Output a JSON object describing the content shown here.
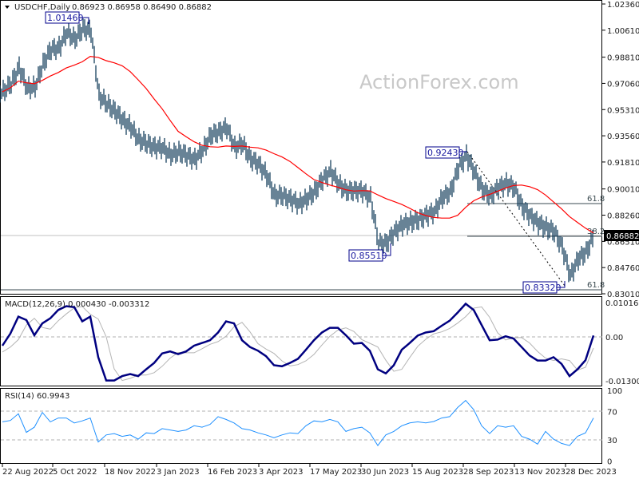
{
  "header": {
    "symbol": "USDCHF,Daily",
    "ohlc": "0.86923 0.86958 0.86490 0.86882",
    "menu_icon": "triangle-down-icon"
  },
  "watermark": "ActionForex.com",
  "current_price_label": "0.86882",
  "annotations": {
    "high_2022": "1.01460",
    "high_sep": "0.92430",
    "low_jul": "0.85510",
    "low_dec": "0.83320",
    "fib_upper": "61.8",
    "fib_mid": "38.2",
    "fib_lower": "61.8"
  },
  "colors": {
    "bars": "#17405e",
    "moving_average": "#ff0000",
    "macd": "#000080",
    "signal": "#b4b4b4",
    "rsi": "#1e90ff",
    "annotation": "#00008b"
  },
  "chart_data": [
    {
      "type": "line",
      "title": "USDCHF,Daily",
      "interval": "weekly samples from 22 Aug 2022",
      "price_axis_ticks": [
        "1.02360",
        "1.00610",
        "0.98810",
        "0.97060",
        "0.95310",
        "0.93560",
        "0.91810",
        "0.90010",
        "0.88260",
        "0.86510",
        "0.84760",
        "0.83010"
      ],
      "ylim": [
        0.8301,
        1.0236
      ],
      "date_ticks": [
        "22 Aug 2022",
        "5 Oct 2022",
        "18 Nov 2022",
        "3 Jan 2023",
        "16 Feb 2023",
        "3 Apr 2023",
        "17 May 2023",
        "30 Jun 2023",
        "15 Aug 2023",
        "28 Sep 2023",
        "13 Nov 2023",
        "28 Dec 2023"
      ],
      "close": [
        0.965,
        0.9703,
        0.981,
        0.9677,
        0.9677,
        0.9837,
        0.9933,
        0.9943,
        1.005,
        0.9996,
        1.0076,
        1.005,
        0.9623,
        0.957,
        0.9517,
        0.9463,
        0.941,
        0.933,
        0.9304,
        0.9277,
        0.9277,
        0.9224,
        0.925,
        0.9224,
        0.9197,
        0.9261,
        0.9357,
        0.9384,
        0.941,
        0.9277,
        0.9304,
        0.9197,
        0.917,
        0.909,
        0.8957,
        0.8957,
        0.893,
        0.8904,
        0.893,
        0.8984,
        0.9064,
        0.9117,
        0.9037,
        0.8984,
        0.8994,
        0.8984,
        0.8941,
        0.8637,
        0.8637,
        0.8717,
        0.876,
        0.8781,
        0.8797,
        0.8824,
        0.8851,
        0.8941,
        0.8984,
        0.9144,
        0.9224,
        0.9117,
        0.8994,
        0.8957,
        0.901,
        0.9037,
        0.901,
        0.8877,
        0.8824,
        0.8771,
        0.8744,
        0.8717,
        0.8611,
        0.8424,
        0.8531,
        0.8584,
        0.8688
      ],
      "key_levels": {
        "high": 1.0146,
        "swing_high": 0.9243,
        "swing_low": 0.8551,
        "low": 0.8332,
        "fib_61_8_upper": 0.8904,
        "fib_38_2": 0.8685,
        "fib_61_8_lower": 0.833
      },
      "last_price": 0.86882
    },
    {
      "type": "line",
      "title": "MACD(12,26,9) 0.000430 -0.003312",
      "axis_ticks": [
        "0.010166",
        "0.00",
        "-0.013006"
      ],
      "ylim": [
        -0.013006,
        0.010166
      ],
      "macd": [
        -0.0026,
        0.001,
        0.006,
        0.005,
        0.0005,
        0.004,
        0.0055,
        0.008,
        0.0091,
        0.0088,
        0.0046,
        0.006,
        -0.006,
        -0.0129,
        -0.0129,
        -0.0116,
        -0.011,
        -0.0116,
        -0.0096,
        -0.0077,
        -0.0049,
        -0.0043,
        -0.0051,
        -0.0043,
        -0.0026,
        -0.0018,
        -0.001,
        0.0013,
        0.0046,
        0.004,
        -0.001,
        -0.003,
        -0.0041,
        -0.0057,
        -0.0084,
        -0.0087,
        -0.0077,
        -0.0065,
        -0.0038,
        -0.001,
        0.0013,
        0.0027,
        0.0027,
        0.0005,
        -0.002,
        -0.0018,
        -0.0041,
        -0.0096,
        -0.0108,
        -0.0084,
        -0.0038,
        -0.0018,
        0.0004,
        0.0013,
        0.0017,
        0.0033,
        0.0048,
        0.0072,
        0.0098,
        0.008,
        0.0035,
        -0.001,
        -0.0008,
        0.0002,
        -0.0005,
        -0.003,
        -0.0055,
        -0.007,
        -0.007,
        -0.006,
        -0.008,
        -0.0116,
        -0.0096,
        -0.0069,
        0.00043
      ],
      "signal": [
        -0.0045,
        -0.003,
        -0.0008,
        0.0035,
        0.0055,
        0.0028,
        0.0023,
        0.0048,
        0.0068,
        0.0086,
        0.009,
        0.0067,
        0.0053,
        0.0,
        -0.0095,
        -0.0129,
        -0.0123,
        -0.0113,
        -0.0113,
        -0.0106,
        -0.0087,
        -0.0063,
        -0.0046,
        -0.0047,
        -0.0047,
        -0.0035,
        -0.0022,
        -0.0014,
        0.0002,
        0.003,
        0.0043,
        0.0015,
        -0.002,
        -0.0036,
        -0.0049,
        -0.0071,
        -0.0086,
        -0.0082,
        -0.0071,
        -0.0052,
        -0.0024,
        0.0002,
        0.002,
        0.0027,
        0.0016,
        -0.0008,
        -0.0019,
        -0.003,
        -0.0069,
        -0.0102,
        -0.0096,
        -0.0061,
        -0.0028,
        -0.0007,
        0.0009,
        0.0015,
        0.0025,
        0.0041,
        0.006,
        0.0085,
        0.0089,
        0.0058,
        0.0012,
        -0.0009,
        -0.0003,
        -0.0002,
        -0.0018,
        -0.0043,
        -0.0063,
        -0.007,
        -0.0065,
        -0.007,
        -0.0098,
        -0.009,
        -0.003312
      ]
    },
    {
      "type": "line",
      "title": "RSI(14) 60.9943",
      "axis_ticks": [
        "100",
        "70",
        "30",
        "0"
      ],
      "ylim": [
        0,
        100
      ],
      "levels": [
        70,
        30
      ],
      "values": [
        55.6,
        57.5,
        67,
        40.6,
        48,
        69,
        55.6,
        61,
        61,
        54,
        57,
        61,
        27,
        37,
        39,
        35,
        37,
        31,
        40,
        39,
        46,
        44,
        42,
        44,
        50,
        48,
        52,
        63,
        59,
        54,
        46,
        44,
        40,
        37,
        33,
        37,
        40,
        39,
        50,
        57,
        55.6,
        59,
        55.6,
        42,
        46,
        48,
        40,
        22,
        37,
        42,
        50,
        54,
        55.6,
        54,
        56,
        61,
        63,
        76,
        86,
        73,
        50,
        39,
        50,
        48,
        50,
        35,
        31,
        24,
        42,
        31,
        25,
        22,
        35,
        40,
        60.99
      ]
    }
  ]
}
